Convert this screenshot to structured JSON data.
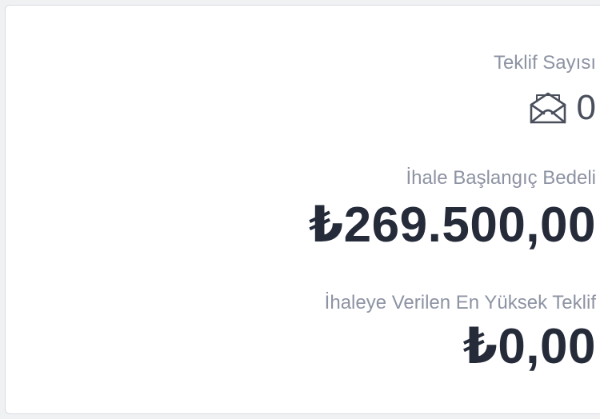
{
  "offer": {
    "label": "Teklif Sayısı",
    "count": "0",
    "icon": "envelope-open-icon"
  },
  "start_price": {
    "label": "İhale Başlangıç Bedeli",
    "value": "₺269.500,00"
  },
  "highest_bid": {
    "label": "İhaleye Verilen En Yüksek Teklif",
    "value": "₺0,00"
  },
  "colors": {
    "label": "#8d93a3",
    "value": "#262b3a",
    "count": "#4a4f5c",
    "card_border": "#d9dbe0"
  }
}
